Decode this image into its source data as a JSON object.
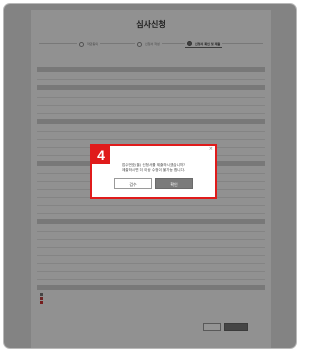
{
  "page": {
    "title": "심사신청"
  },
  "steps": [
    {
      "label": "약관동의",
      "active": false
    },
    {
      "label": "신청서 작성",
      "active": false
    },
    {
      "label": "신청서 확인 및 제출",
      "active": true
    }
  ],
  "confirm_dialog": {
    "step_badge": "4",
    "message_line1": "접수번호(을) 신청서를 제출하시겠습니까?",
    "message_line2": "제출하시면 더 이상 수정이 불가능 합니다.",
    "cancel_label": "검수",
    "confirm_label": "확인",
    "close_icon": "close-icon"
  },
  "colors": {
    "badge": "#e01b1b",
    "overlay": "rgba(0,0,0,0.42)",
    "confirm_button": "#7b7b7b"
  }
}
